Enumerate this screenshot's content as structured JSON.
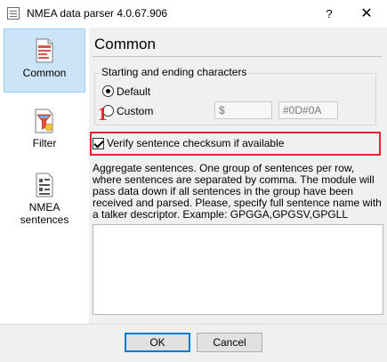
{
  "window": {
    "title": "NMEA data parser 4.0.67.906",
    "help": "?",
    "close": "✕"
  },
  "sidebar": {
    "items": [
      {
        "label": "Common",
        "icon": "document-settings-icon",
        "selected": true
      },
      {
        "label": "Filter",
        "icon": "filter-funnel-icon",
        "selected": false
      },
      {
        "label": "NMEA\nsentences",
        "label_line1": "NMEA",
        "label_line2": "sentences",
        "icon": "nmea-document-icon",
        "selected": false
      }
    ]
  },
  "main": {
    "title": "Common",
    "chars_group": {
      "legend": "Starting and ending characters",
      "default_label": "Default",
      "custom_label": "Custom",
      "start_value": "$",
      "end_value": "#0D#0A",
      "selected": "Default"
    },
    "verify_checkbox": {
      "label": "Verify sentence checksum if available",
      "checked": true
    },
    "annotation": "1",
    "description": "Aggregate sentences. One group of sentences per row, where sentences are separated by comma. The module will pass data down if all sentences in the group have been received and parsed. Please, specify full sentence name with a talker descriptor. Example: GPGGA,GPGSV,GPGLL",
    "aggregate_value": ""
  },
  "footer": {
    "ok_label": "OK",
    "cancel_label": "Cancel"
  },
  "colors": {
    "selected_bg": "#cce4f7",
    "highlight": "#e8232f",
    "panel_bg": "#f0f0f0"
  }
}
